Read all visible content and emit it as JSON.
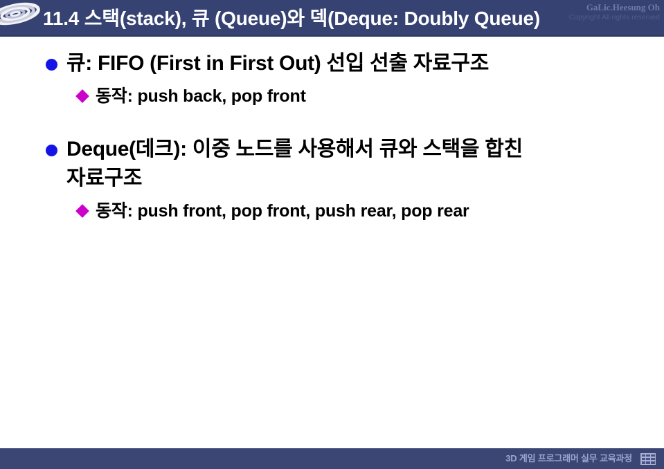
{
  "slide": {
    "header": {
      "title": "11.4 스택(stack), 큐 (Queue)와 덱(Deque: Doubly Queue)",
      "logo_icon": "ripple-spiral-logo",
      "watermark_line1": "GaLic.Heesung Oh",
      "watermark_line2": "Copyright All rights reserved",
      "bg_color": "#364272",
      "title_color": "#ffffff"
    },
    "body": {
      "bg_color": "#ffffff",
      "blocks": [
        {
          "level1": "큐: FIFO (First in First Out) 선입 선출 자료구조",
          "level1_wrap": "",
          "level2": "동작: push back, pop front"
        },
        {
          "level1": "Deque(데크): 이중 노드를 사용해서 큐와 스택을 합친",
          "level1_wrap": "자료구조",
          "level2": "동작: push front, pop front, push rear, pop rear"
        }
      ],
      "marker_level1_color": "#1414e6",
      "marker_level2_color": "#cc00cc"
    },
    "footer": {
      "label": "3D 게임 프로그래머 실무 교육과정",
      "grid_icon": "grid-3x3-icon",
      "bg_color": "#3b4674",
      "text_color": "#9aa5cd"
    }
  }
}
